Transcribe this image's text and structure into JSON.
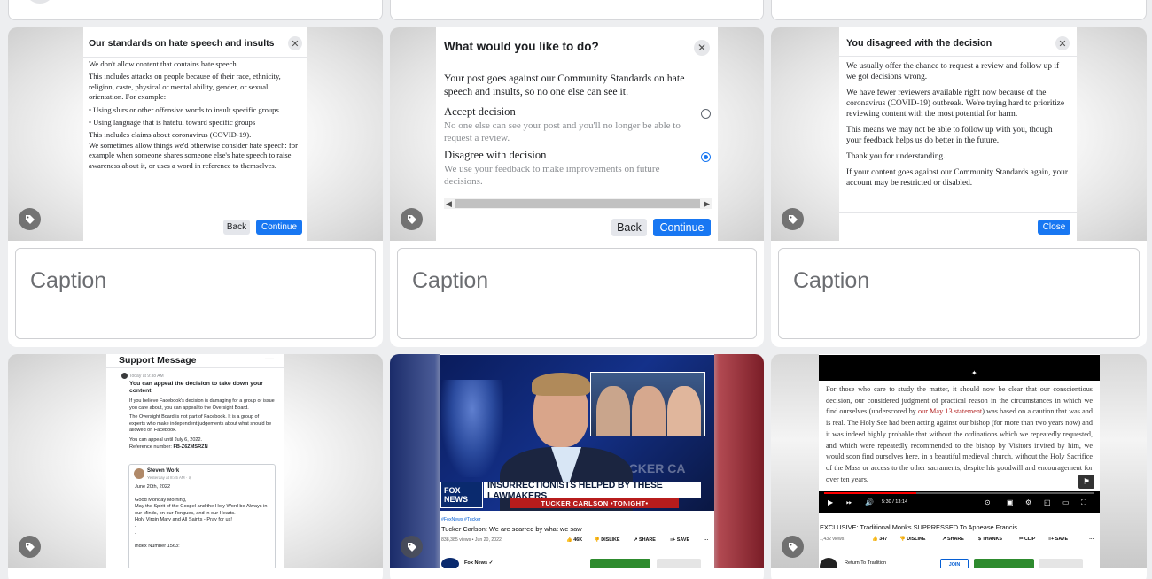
{
  "cards": [
    {
      "type": "dialog-standards",
      "title": "Our standards on hate speech and insults",
      "paragraphs": [
        "We don't allow content that contains hate speech.",
        "This includes attacks on people because of their race, ethnicity, religion, caste, physical or mental ability, gender, or sexual orientation. For example:",
        "• Using slurs or other offensive words to insult specific groups",
        "• Using language that is hateful toward specific groups",
        "This includes claims about coronavirus (COVID-19).",
        "We sometimes allow things we'd otherwise consider hate speech: for example when someone shares someone else's hate speech to raise awareness about it, or uses a word in reference to themselves."
      ],
      "back_label": "Back",
      "continue_label": "Continue",
      "caption_placeholder": "Caption"
    },
    {
      "type": "dialog-choice",
      "title": "What would you like to do?",
      "intro": "Your post goes against our Community Standards on hate speech and insults, so no one else can see it.",
      "options": [
        {
          "label": "Accept decision",
          "desc": "No one else can see your post and you'll no longer be able to request a review.",
          "selected": false
        },
        {
          "label": "Disagree with decision",
          "desc": "We use your feedback to make improvements on future decisions.",
          "selected": true
        }
      ],
      "back_label": "Back",
      "continue_label": "Continue",
      "caption_placeholder": "Caption"
    },
    {
      "type": "dialog-disagreed",
      "title": "You disagreed with the decision",
      "paragraphs": [
        "We usually offer the chance to request a review and follow up if we got decisions wrong.",
        "We have fewer reviewers available right now because of the coronavirus (COVID-19) outbreak. We're trying hard to prioritize reviewing content with the most potential for harm.",
        "This means we may not be able to follow up with you, though your feedback helps us do better in the future.",
        "Thank you for understanding.",
        "If your content goes against our Community Standards again, your account may be restricted or disabled."
      ],
      "close_label": "Close",
      "caption_placeholder": "Caption"
    }
  ],
  "support_message": {
    "title": "Support Message",
    "menu": "—",
    "time": "Today at 9:38 AM",
    "lead": "You can appeal the decision to take down your content",
    "p1": "If you believe Facebook's decision is damaging for a group or issue you care about, you can appeal to the Oversight Board.",
    "p2": "The Oversight Board is not part of Facebook. It is a group of experts who make independent judgements about what should be allowed on Facebook.",
    "p3": "You can appeal until July 6, 2022.",
    "ref_label": "Reference number:",
    "ref_value": "FB-Z6ZMSRZN",
    "reply_name": "Steven Work",
    "reply_time": "Yesterday at 8:45 AM · ⊘",
    "reply_lines": [
      "June 20th, 2022",
      "",
      "Good Monday Morning,",
      "May the Spirit of the Gospel and the Holy Word be Always in our Minds, on our Tongues, and in our Hearts.",
      "Holy Virgin Mary and All Saints - Pray for us!",
      "-",
      "-",
      "",
      "Index Number 1563:"
    ]
  },
  "tucker_video": {
    "fox_logo": "FOX NEWS",
    "headline": "INSURRECTIONISTS HELPED BY THESE LAWMAKERS",
    "subline": "TUCKER CARLSON •TONIGHT•",
    "backdrop_text": "TUCKER CA",
    "hashtags": "#FoxNews #Tucker",
    "title": "Tucker Carlson: We are scarred by what we saw",
    "meta": "838,385 views • Jun 20, 2022",
    "likes": "46K",
    "dislike": "DISLIKE",
    "share": "SHARE",
    "save": "SAVE",
    "more": "…",
    "channel": "Fox News",
    "verified": "✓"
  },
  "monks_video": {
    "text_before": "For those who care to study the matter, it should now be clear that our conscientious decision, our considered judgment of practical reason in the circumstances in which we find ourselves (underscored by ",
    "text_red": "our May 13 statement",
    "text_after": ") was based on a caution that was and is real. The Holy See had been acting against our bishop (for more than two years now) and it was indeed highly probable that without the ordinations which we repeatedly requested, and which were repeatedly recommended to the bishop by Visitors invited by him, we would soon find ourselves here, in a beautiful medieval church, without the Holy Sacrifice of the Mass or access to the other sacraments, despite his goodwill and encouragement for over ten years.",
    "time": "5:30 / 13:14",
    "progress": 0.34,
    "title": "EXCLUSIVE: Traditional Monks SUPPRESSED To Appease Francis",
    "meta": "1,432 views",
    "likes": "347",
    "dislike": "DISLIKE",
    "share": "SHARE",
    "thanks": "THANKS",
    "clip": "CLIP",
    "save": "SAVE",
    "more": "…",
    "channel": "Return To Tradition",
    "join": "JOIN"
  },
  "icons": {
    "tag": "tag-icon",
    "close": "close-icon"
  }
}
